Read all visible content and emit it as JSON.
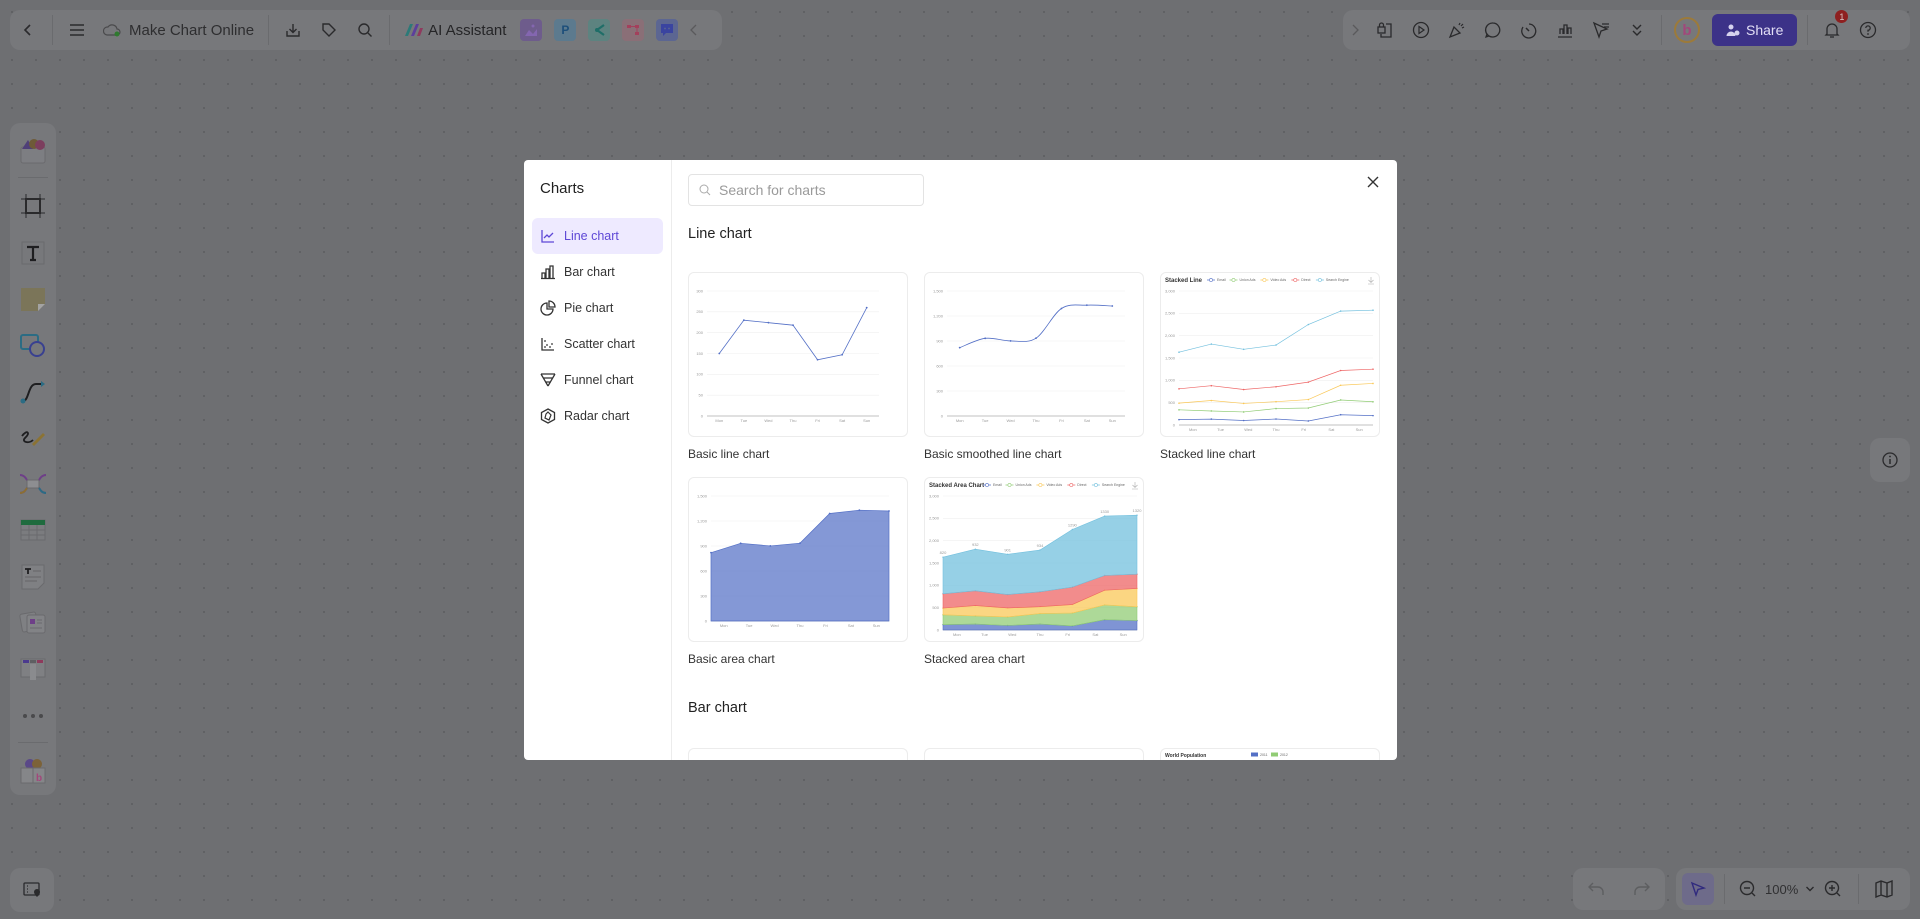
{
  "topbar": {
    "back_icon": "chevron-left-icon",
    "menu_icon": "hamburger-icon",
    "doc_title": "Make Chart Online",
    "cloud_icon": "cloud-saved-icon",
    "tools": [
      "download-icon",
      "tag-icon",
      "search-icon"
    ],
    "ai_assistant_label": "AI Assistant",
    "apps": [
      "image-generator-app",
      "presentation-app",
      "mindmap-app",
      "flowchart-app",
      "chat-app"
    ],
    "collapse_icon": "chevron-left-icon",
    "right_tools": [
      "expand-icon",
      "lock-file-icon",
      "play-icon",
      "celebrate-icon",
      "comment-icon",
      "timer-icon",
      "chart-icon",
      "laser-pointer-icon",
      "more-chevrons-icon"
    ],
    "share_label": "Share",
    "notification_count": "1",
    "help_icon": "help-icon"
  },
  "left_toolbar": {
    "items": [
      "templates",
      "frame",
      "text",
      "sticky-note",
      "shapes",
      "connector",
      "pen",
      "mindmap",
      "table",
      "text-card",
      "cards",
      "kanban",
      "more",
      "app-store"
    ]
  },
  "bottom": {
    "zoom_level": "100%",
    "undo_icon": "undo-icon",
    "redo_icon": "redo-icon"
  },
  "modal": {
    "title": "Charts",
    "categories": [
      {
        "label": "Line chart",
        "icon": "line-chart-icon",
        "active": true
      },
      {
        "label": "Bar chart",
        "icon": "bar-chart-icon",
        "active": false
      },
      {
        "label": "Pie chart",
        "icon": "pie-chart-icon",
        "active": false
      },
      {
        "label": "Scatter chart",
        "icon": "scatter-chart-icon",
        "active": false
      },
      {
        "label": "Funnel chart",
        "icon": "funnel-chart-icon",
        "active": false
      },
      {
        "label": "Radar chart",
        "icon": "radar-chart-icon",
        "active": false
      }
    ],
    "search_placeholder": "Search for charts",
    "sections": [
      {
        "title": "Line chart",
        "cards": [
          {
            "label": "Basic line chart"
          },
          {
            "label": "Basic smoothed line chart"
          },
          {
            "label": "Stacked line chart"
          },
          {
            "label": "Basic area chart"
          },
          {
            "label": "Stacked area chart"
          }
        ]
      },
      {
        "title": "Bar chart",
        "cards": [
          {
            "label": ""
          },
          {
            "label": ""
          },
          {
            "label": ""
          }
        ]
      }
    ]
  },
  "chart_data": [
    {
      "type": "line",
      "name": "Basic line chart",
      "categories": [
        "Mon",
        "Tue",
        "Wed",
        "Thu",
        "Fri",
        "Sat",
        "Sun"
      ],
      "values": [
        150,
        230,
        224,
        218,
        135,
        147,
        260
      ],
      "ylim": [
        0,
        300
      ],
      "yticks": [
        "0",
        "50",
        "100",
        "150",
        "200",
        "250",
        "300"
      ],
      "color": "#5470c6"
    },
    {
      "type": "line",
      "name": "Basic smoothed line chart",
      "smooth": true,
      "categories": [
        "Mon",
        "Tue",
        "Wed",
        "Thu",
        "Fri",
        "Sat",
        "Sun"
      ],
      "values": [
        820,
        932,
        901,
        934,
        1290,
        1330,
        1320
      ],
      "ylim": [
        0,
        1500
      ],
      "yticks": [
        "0",
        "300",
        "600",
        "900",
        "1,200",
        "1,500"
      ],
      "color": "#5470c6"
    },
    {
      "type": "line",
      "name": "Stacked line chart",
      "title": "Stacked Line",
      "categories": [
        "Mon",
        "Tue",
        "Wed",
        "Thu",
        "Fri",
        "Sat",
        "Sun"
      ],
      "ylim": [
        0,
        3000
      ],
      "yticks": [
        "0",
        "500",
        "1,000",
        "1,500",
        "2,000",
        "2,500",
        "3,000"
      ],
      "series": [
        {
          "name": "Email",
          "color": "#5470c6",
          "values": [
            120,
            132,
            101,
            134,
            90,
            230,
            210
          ]
        },
        {
          "name": "Union Ads",
          "color": "#91cc75",
          "values": [
            340,
            314,
            292,
            368,
            380,
            560,
            520
          ]
        },
        {
          "name": "Video Ads",
          "color": "#fac858",
          "values": [
            490,
            548,
            483,
            522,
            570,
            890,
            930
          ]
        },
        {
          "name": "Direct",
          "color": "#ee6666",
          "values": [
            810,
            880,
            794,
            856,
            960,
            1220,
            1250
          ]
        },
        {
          "name": "Search Engine",
          "color": "#73c0de",
          "values": [
            1630,
            1812,
            1695,
            1790,
            2250,
            2550,
            2570
          ]
        }
      ]
    },
    {
      "type": "area",
      "name": "Basic area chart",
      "categories": [
        "Mon",
        "Tue",
        "Wed",
        "Thu",
        "Fri",
        "Sat",
        "Sun"
      ],
      "values": [
        820,
        932,
        901,
        934,
        1290,
        1330,
        1320
      ],
      "ylim": [
        0,
        1500
      ],
      "yticks": [
        "0",
        "300",
        "600",
        "900",
        "1,200",
        "1,500"
      ],
      "color": "#5470c6"
    },
    {
      "type": "area",
      "name": "Stacked area chart",
      "title": "Stacked Area Chart",
      "categories": [
        "Mon",
        "Tue",
        "Wed",
        "Thu",
        "Fri",
        "Sat",
        "Sun"
      ],
      "ylim": [
        0,
        3000
      ],
      "yticks": [
        "0",
        "500",
        "1,000",
        "1,500",
        "2,000",
        "2,500",
        "3,000"
      ],
      "top_labels": [
        "820",
        "932",
        "901",
        "934",
        "1290",
        "1330",
        "1320"
      ],
      "series": [
        {
          "name": "Email",
          "color": "#5470c6",
          "values": [
            120,
            132,
            101,
            134,
            90,
            230,
            210
          ]
        },
        {
          "name": "Union Ads",
          "color": "#91cc75",
          "values": [
            220,
            182,
            191,
            234,
            290,
            330,
            310
          ]
        },
        {
          "name": "Video Ads",
          "color": "#fac858",
          "values": [
            150,
            232,
            201,
            154,
            190,
            330,
            410
          ]
        },
        {
          "name": "Direct",
          "color": "#ee6666",
          "values": [
            320,
            332,
            301,
            334,
            390,
            330,
            320
          ]
        },
        {
          "name": "Search Engine",
          "color": "#73c0de",
          "values": [
            820,
            932,
            901,
            934,
            1290,
            1330,
            1320
          ]
        }
      ]
    },
    {
      "type": "bar",
      "name": "World Population (partially visible)",
      "title": "World Population",
      "legend": [
        "2011",
        "2012"
      ],
      "colors": [
        "#5470c6",
        "#91cc75"
      ]
    }
  ]
}
